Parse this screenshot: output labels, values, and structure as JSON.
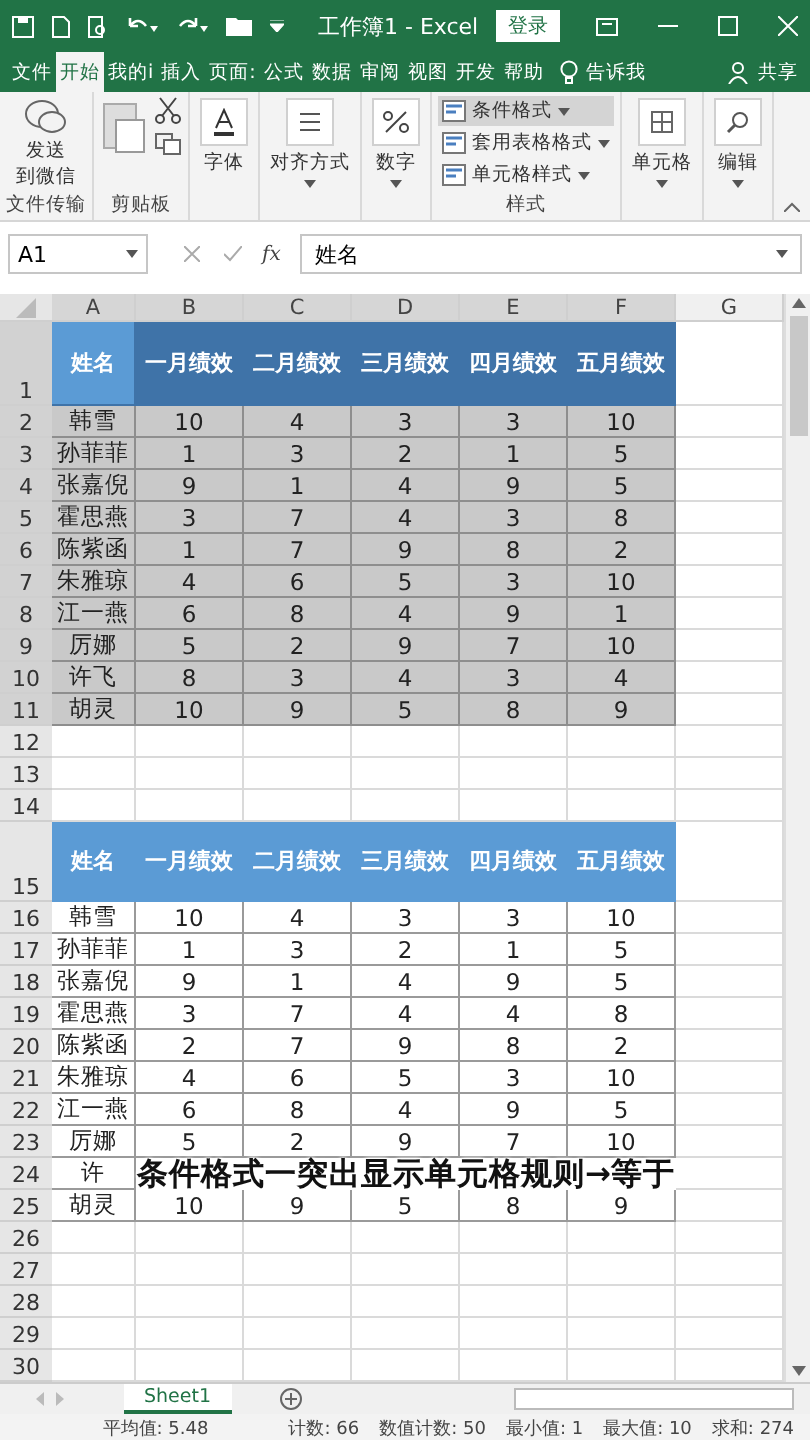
{
  "title_bar": {
    "title": "工作簿1 - Excel",
    "login_button": "登录"
  },
  "tabs": [
    {
      "label": "文件",
      "selected": false
    },
    {
      "label": "开始",
      "selected": true
    },
    {
      "label": "我的i",
      "selected": false
    },
    {
      "label": "插入",
      "selected": false
    },
    {
      "label": "页面:",
      "selected": false
    },
    {
      "label": "公式",
      "selected": false
    },
    {
      "label": "数据",
      "selected": false
    },
    {
      "label": "审阅",
      "selected": false
    },
    {
      "label": "视图",
      "selected": false
    },
    {
      "label": "开发",
      "selected": false
    },
    {
      "label": "帮助",
      "selected": false
    }
  ],
  "tell_me": "告诉我",
  "share": "共享",
  "ribbon": {
    "groups": [
      {
        "kind": "send",
        "lines": [
          "发送",
          "到微信"
        ],
        "label": "文件传输"
      },
      {
        "kind": "clipboard",
        "label": "剪贴板"
      },
      {
        "kind": "font",
        "button": "字体"
      },
      {
        "kind": "align",
        "button": "对齐方式"
      },
      {
        "kind": "number",
        "button": "数字"
      },
      {
        "kind": "styles",
        "items": [
          {
            "label": "条件格式",
            "selected": true
          },
          {
            "label": "套用表格格式",
            "selected": false
          },
          {
            "label": "单元格样式",
            "selected": false
          }
        ],
        "label": "样式"
      },
      {
        "kind": "cells",
        "button": "单元格"
      },
      {
        "kind": "edit",
        "button": "编辑"
      }
    ]
  },
  "formula_bar": {
    "name_box": "A1",
    "function_label": "fx",
    "value": "姓名"
  },
  "columns": [
    {
      "label": "A",
      "selected": true
    },
    {
      "label": "B",
      "selected": true
    },
    {
      "label": "C",
      "selected": true
    },
    {
      "label": "D",
      "selected": true
    },
    {
      "label": "E",
      "selected": true
    },
    {
      "label": "F",
      "selected": true
    },
    {
      "label": "G",
      "selected": false
    }
  ],
  "rows": [
    {
      "number": "1",
      "kind": "header",
      "selected": true,
      "cells": [
        "姓名",
        "一月绩效",
        "二月绩效",
        "三月绩效",
        "四月绩效",
        "五月绩效"
      ]
    },
    {
      "number": "2",
      "kind": "data",
      "selected": true,
      "cells": [
        "韩雪",
        "10",
        "4",
        "3",
        "3",
        "10"
      ]
    },
    {
      "number": "3",
      "kind": "data",
      "selected": true,
      "cells": [
        "孙菲菲",
        "1",
        "3",
        "2",
        "1",
        "5"
      ]
    },
    {
      "number": "4",
      "kind": "data",
      "selected": true,
      "cells": [
        "张嘉倪",
        "9",
        "1",
        "4",
        "9",
        "5"
      ]
    },
    {
      "number": "5",
      "kind": "data",
      "selected": true,
      "cells": [
        "霍思燕",
        "3",
        "7",
        "4",
        "3",
        "8"
      ]
    },
    {
      "number": "6",
      "kind": "data",
      "selected": true,
      "cells": [
        "陈紫函",
        "1",
        "7",
        "9",
        "8",
        "2"
      ]
    },
    {
      "number": "7",
      "kind": "data",
      "selected": true,
      "cells": [
        "朱雅琼",
        "4",
        "6",
        "5",
        "3",
        "10"
      ]
    },
    {
      "number": "8",
      "kind": "data",
      "selected": true,
      "cells": [
        "江一燕",
        "6",
        "8",
        "4",
        "9",
        "1"
      ]
    },
    {
      "number": "9",
      "kind": "data",
      "selected": true,
      "cells": [
        "厉娜",
        "5",
        "2",
        "9",
        "7",
        "10"
      ]
    },
    {
      "number": "10",
      "kind": "data",
      "selected": true,
      "cells": [
        "许飞",
        "8",
        "3",
        "4",
        "3",
        "4"
      ]
    },
    {
      "number": "11",
      "kind": "data",
      "selected": true,
      "cells": [
        "胡灵",
        "10",
        "9",
        "5",
        "8",
        "9"
      ]
    },
    {
      "number": "12",
      "kind": "empty",
      "selected": false
    },
    {
      "number": "13",
      "kind": "empty",
      "selected": false
    },
    {
      "number": "14",
      "kind": "empty",
      "selected": false
    },
    {
      "number": "15",
      "kind": "header",
      "selected": false,
      "cells": [
        "姓名",
        "一月绩效",
        "二月绩效",
        "三月绩效",
        "四月绩效",
        "五月绩效"
      ]
    },
    {
      "number": "16",
      "kind": "data",
      "selected": false,
      "cells": [
        "韩雪",
        "10",
        "4",
        "3",
        "3",
        "10"
      ]
    },
    {
      "number": "17",
      "kind": "data",
      "selected": false,
      "cells": [
        "孙菲菲",
        "1",
        "3",
        "2",
        "1",
        "5"
      ]
    },
    {
      "number": "18",
      "kind": "data",
      "selected": false,
      "cells": [
        "张嘉倪",
        "9",
        "1",
        "4",
        "9",
        "5"
      ]
    },
    {
      "number": "19",
      "kind": "data",
      "selected": false,
      "cells": [
        "霍思燕",
        "3",
        "7",
        "4",
        "4",
        "8"
      ]
    },
    {
      "number": "20",
      "kind": "data",
      "selected": false,
      "cells": [
        "陈紫函",
        "2",
        "7",
        "9",
        "8",
        "2"
      ]
    },
    {
      "number": "21",
      "kind": "data",
      "selected": false,
      "cells": [
        "朱雅琼",
        "4",
        "6",
        "5",
        "3",
        "10"
      ]
    },
    {
      "number": "22",
      "kind": "data",
      "selected": false,
      "cells": [
        "江一燕",
        "6",
        "8",
        "4",
        "9",
        "5"
      ]
    },
    {
      "number": "23",
      "kind": "data",
      "selected": false,
      "cells": [
        "厉娜",
        "5",
        "2",
        "9",
        "7",
        "10"
      ]
    },
    {
      "number": "24",
      "kind": "data",
      "selected": false,
      "cells": [
        "许"
      ],
      "caption": "条件格式一突出显示单元格规则→等于"
    },
    {
      "number": "25",
      "kind": "data",
      "selected": false,
      "cells": [
        "胡灵",
        "10",
        "9",
        "5",
        "8",
        "9"
      ]
    },
    {
      "number": "26",
      "kind": "empty",
      "selected": false
    },
    {
      "number": "27",
      "kind": "empty",
      "selected": false
    },
    {
      "number": "28",
      "kind": "empty",
      "selected": false
    },
    {
      "number": "29",
      "kind": "empty",
      "selected": false
    },
    {
      "number": "30",
      "kind": "empty",
      "selected": false
    }
  ],
  "sheet_tabs": [
    {
      "label": "Sheet1",
      "selected": true
    }
  ],
  "status_bar": [
    "平均值: 5.48",
    "计数: 66",
    "数值计数: 50",
    "最小值: 1",
    "最大值: 10",
    "求和: 274"
  ]
}
